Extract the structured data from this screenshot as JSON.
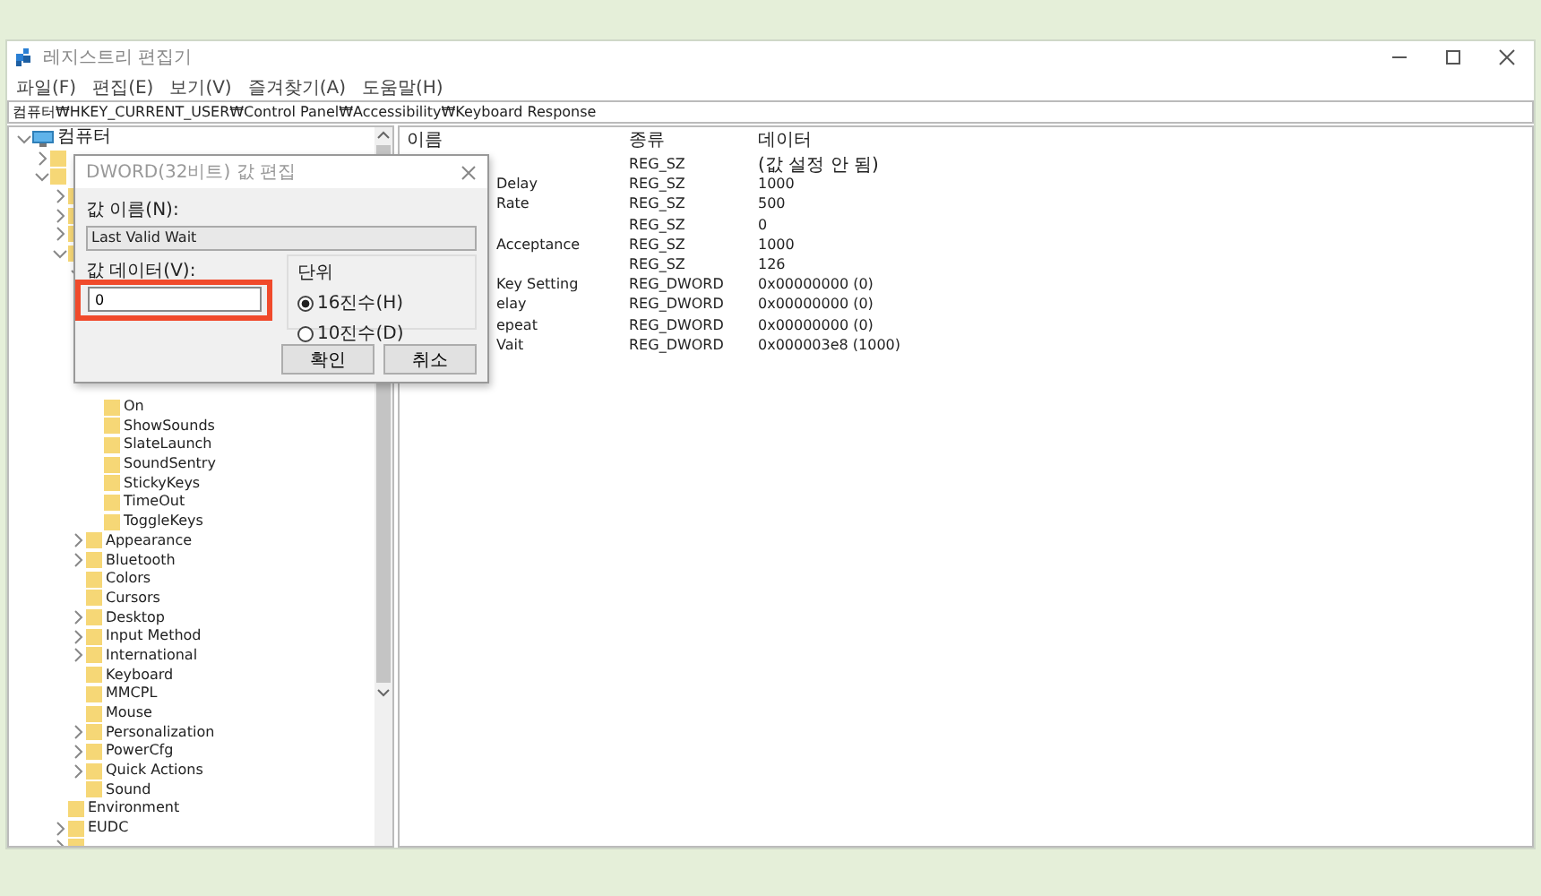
{
  "window": {
    "title": "레지스트리 편집기"
  },
  "menu": [
    "파일(F)",
    "편집(E)",
    "보기(V)",
    "즐겨찾기(A)",
    "도움말(H)"
  ],
  "address": "컴퓨터₩HKEY_CURRENT_USER₩Control Panel₩Accessibility₩Keyboard Response",
  "tree": [
    {
      "label": "컴퓨터",
      "kind": "computer",
      "expanded": true,
      "children": [
        {
          "expanded": false
        },
        {
          "expanded": true,
          "children": [
            {
              "expanded": false
            },
            {
              "expanded": false
            },
            {
              "expanded": false
            },
            {
              "expanded": true,
              "children": [
                {
                  "expanded": true,
                  "children": [
                    {
                      "label": "On"
                    },
                    {
                      "label": "ShowSounds"
                    },
                    {
                      "label": "SlateLaunch"
                    },
                    {
                      "label": "SoundSentry"
                    },
                    {
                      "label": "StickyKeys"
                    },
                    {
                      "label": "TimeOut"
                    },
                    {
                      "label": "ToggleKeys"
                    }
                  ]
                },
                {
                  "label": "Appearance",
                  "expanded": false
                },
                {
                  "label": "Bluetooth",
                  "expanded": false
                },
                {
                  "label": "Colors"
                },
                {
                  "label": "Cursors"
                },
                {
                  "label": "Desktop",
                  "expanded": false
                },
                {
                  "label": "Input Method",
                  "expanded": false
                },
                {
                  "label": "International",
                  "expanded": false
                },
                {
                  "label": "Keyboard"
                },
                {
                  "label": "MMCPL"
                },
                {
                  "label": "Mouse"
                },
                {
                  "label": "Personalization",
                  "expanded": false
                },
                {
                  "label": "PowerCfg",
                  "expanded": false
                },
                {
                  "label": "Quick Actions",
                  "expanded": false
                },
                {
                  "label": "Sound"
                }
              ]
            },
            {
              "label": "Environment"
            },
            {
              "label": "EUDC",
              "expanded": false
            },
            {
              "expanded": false
            }
          ]
        }
      ]
    }
  ],
  "table": {
    "columns": [
      "이름",
      "종류",
      "데이터"
    ],
    "rows": [
      {
        "type": "REG_SZ",
        "data": "(값 설정 안 됨)"
      },
      {
        "name": "Delay",
        "type": "REG_SZ",
        "data": "1000"
      },
      {
        "name": "Rate",
        "type": "REG_SZ",
        "data": "500"
      },
      {
        "type": "REG_SZ",
        "data": "0"
      },
      {
        "name": "Acceptance",
        "type": "REG_SZ",
        "data": "1000"
      },
      {
        "type": "REG_SZ",
        "data": "126"
      },
      {
        "name": "Key Setting",
        "type": "REG_DWORD",
        "data": "0x00000000 (0)"
      },
      {
        "name": "elay",
        "type": "REG_DWORD",
        "data": "0x00000000 (0)"
      },
      {
        "name": "epeat",
        "type": "REG_DWORD",
        "data": "0x00000000 (0)"
      },
      {
        "name": "Vait",
        "type": "REG_DWORD",
        "data": "0x000003e8 (1000)"
      }
    ]
  },
  "dialog": {
    "title": "DWORD(32비트) 값 편집",
    "name_label": "값 이름(N):",
    "name_value": "Last Valid Wait",
    "data_label": "값 데이터(V):",
    "data_value": "0",
    "highlighted": true,
    "base_label": "단위",
    "bases": [
      {
        "label": "16진수(H)",
        "selected": true
      },
      {
        "label": "10진수(D)",
        "selected": false
      }
    ],
    "buttons": [
      "확인",
      "취소"
    ]
  }
}
